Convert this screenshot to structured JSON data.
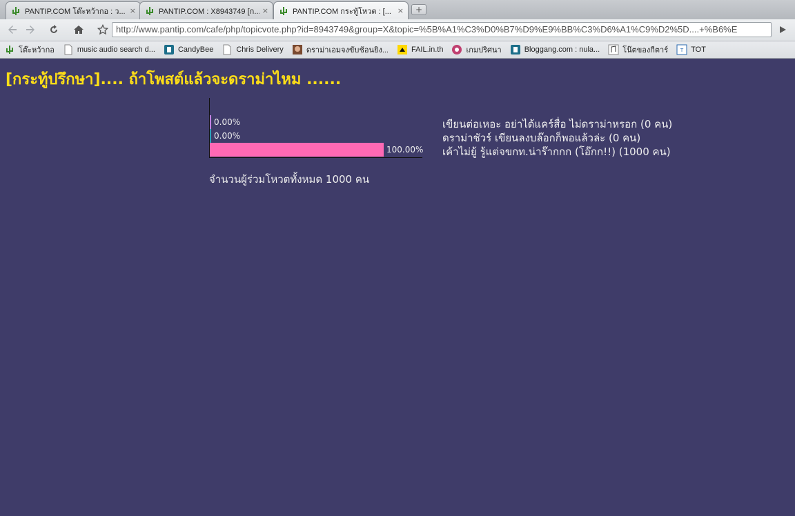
{
  "browser": {
    "tabs": [
      {
        "label": "PANTIP.COM โต๊ะหว้ากอ : ว...",
        "icon": "cactus-icon",
        "active": false
      },
      {
        "label": "PANTIP.COM : X8943749 [ก...",
        "icon": "cactus-icon",
        "active": false
      },
      {
        "label": "PANTIP.COM กระทู้โหวต : [...",
        "icon": "cactus-icon",
        "active": true
      }
    ],
    "new_tab_glyph": "+",
    "close_glyph": "×",
    "url": "http://www.pantip.com/cafe/php/topicvote.php?id=8943749&group=X&topic=%5B%A1%C3%D0%B7%D9%E9%BB%C3%D6%A1%C9%D2%5D....+%B6%E",
    "bookmarks": [
      {
        "label": "โต๊ะหว้ากอ",
        "icon": "cactus-icon"
      },
      {
        "label": "music audio search d...",
        "icon": "page-icon"
      },
      {
        "label": "CandyBee",
        "icon": "bloggang-icon"
      },
      {
        "label": "Chris Delivery",
        "icon": "page-icon"
      },
      {
        "label": "ดราม่าเอมจงขับช้อนยิง...",
        "icon": "photo-icon"
      },
      {
        "label": "FAIL.in.th",
        "icon": "fail-icon"
      },
      {
        "label": "เกมปริศนา",
        "icon": "game-icon"
      },
      {
        "label": "Bloggang.com : nula...",
        "icon": "bloggang-icon"
      },
      {
        "label": "โน๊ตของกีตาร์",
        "icon": "note-icon"
      },
      {
        "label": "TOT",
        "icon": "tot-icon"
      }
    ]
  },
  "page": {
    "title": "[กระทู้ปรึกษา].... ถ้าโพสต์แล้วจะดราม่าไหม ......",
    "total_label": "จำนวนผู้ร่วมโหวตทั้งหมด 1000 คน"
  },
  "colors": {
    "page_bg": "#3f3c69",
    "title": "#ffde17",
    "bars": [
      "#c080e0",
      "#2aa0b8",
      "#ff69b4"
    ]
  },
  "chart_data": {
    "type": "bar",
    "orientation": "horizontal",
    "categories": [
      "เขียนต่อเหอะ อย่าได้แคร์สื่อ ไม่ดราม่าหรอก (0 คน)",
      "ดราม่าชัวร์ เขียนลงบล๊อกก็พอแล้วล่ะ (0 คน)",
      "เค้าไม่ยู้ รู้แต่จขกท.น่าร๊ากกก (โอ๊กก!!) (1000 คน)"
    ],
    "values": [
      0,
      0,
      100
    ],
    "value_labels": [
      "0.00%",
      "0.00%",
      "100.00%"
    ],
    "counts": [
      0,
      0,
      1000
    ],
    "xlim": [
      0,
      100
    ]
  }
}
